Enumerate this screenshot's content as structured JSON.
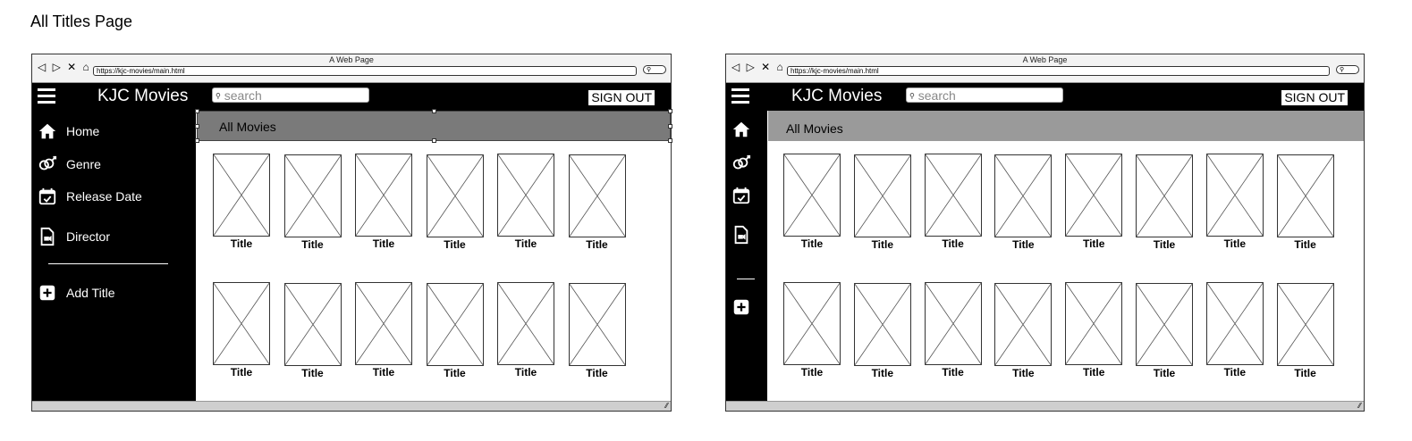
{
  "page": {
    "heading": "All Titles Page"
  },
  "browsers": [
    {
      "window_title": "A Web Page",
      "nav_buttons": "◁ ▷ ✕ ⌂",
      "url": "https://kjc-movies/main.html",
      "app": {
        "brand": "KJC Movies",
        "search_placeholder": "search",
        "sign_out": "SIGN OUT"
      },
      "sidebar": {
        "expanded": true,
        "items": [
          {
            "icon": "home-icon",
            "label": "Home"
          },
          {
            "icon": "genre-icon",
            "label": "Genre"
          },
          {
            "icon": "calendar-check-icon",
            "label": "Release Date"
          },
          {
            "icon": "video-file-icon",
            "label": "Director"
          },
          {
            "icon": "plus-square-icon",
            "label": "Add Title"
          }
        ]
      },
      "section": {
        "title": "All Movies"
      },
      "grid": {
        "rows": [
          [
            "Title",
            "Title",
            "Title",
            "Title",
            "Title",
            "Title"
          ],
          [
            "Title",
            "Title",
            "Title",
            "Title",
            "Title",
            "Title"
          ]
        ]
      }
    },
    {
      "window_title": "A Web Page",
      "nav_buttons": "◁ ▷ ✕ ⌂",
      "url": "https://kjc-movies/main.html",
      "app": {
        "brand": "KJC Movies",
        "search_placeholder": "search",
        "sign_out": "SIGN OUT"
      },
      "sidebar": {
        "expanded": false,
        "items": [
          {
            "icon": "home-icon",
            "label": ""
          },
          {
            "icon": "genre-icon",
            "label": ""
          },
          {
            "icon": "calendar-check-icon",
            "label": ""
          },
          {
            "icon": "video-file-icon",
            "label": ""
          },
          {
            "icon": "plus-square-icon",
            "label": ""
          }
        ]
      },
      "section": {
        "title": "All Movies"
      },
      "grid": {
        "rows": [
          [
            "Title",
            "Title",
            "Title",
            "Title",
            "Title",
            "Title",
            "Title",
            "Title"
          ],
          [
            "Title",
            "Title",
            "Title",
            "Title",
            "Title",
            "Title",
            "Title",
            "Title"
          ]
        ]
      }
    }
  ],
  "colors": {
    "bar": "#000000",
    "selected_section": "#7a7a7a",
    "section": "#9a9a9a"
  }
}
